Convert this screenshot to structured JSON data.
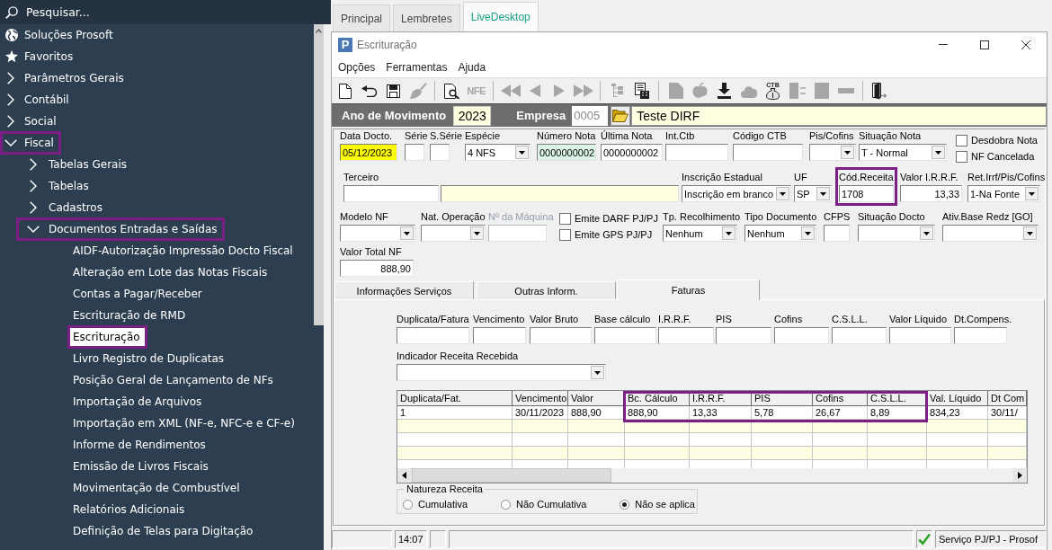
{
  "sidebar": {
    "search": {
      "placeholder": "Pesquisar..."
    },
    "items": [
      {
        "kind": "globe",
        "label": "Soluções Prosoft",
        "selected": false,
        "highlighted": false
      },
      {
        "kind": "star",
        "label": "Favoritos",
        "selected": false,
        "highlighted": false
      },
      {
        "kind": "folder",
        "label": "Parâmetros Gerais",
        "expanded": false,
        "selected": false,
        "highlighted": false
      },
      {
        "kind": "folder",
        "label": "Contábil",
        "expanded": false,
        "selected": false,
        "highlighted": false
      },
      {
        "kind": "folder",
        "label": "Social",
        "expanded": false,
        "selected": false,
        "highlighted": false
      },
      {
        "kind": "folder",
        "label": "Fiscal",
        "expanded": true,
        "selected": false,
        "highlighted": true,
        "children": [
          {
            "kind": "folder",
            "label": "Tabelas Gerais",
            "expanded": false,
            "selected": false,
            "highlighted": false
          },
          {
            "kind": "folder",
            "label": "Tabelas",
            "expanded": false,
            "selected": false,
            "highlighted": false
          },
          {
            "kind": "folder",
            "label": "Cadastros",
            "expanded": false,
            "selected": false,
            "highlighted": false
          },
          {
            "kind": "folder",
            "label": "Documentos Entradas e Saídas",
            "expanded": true,
            "selected": false,
            "highlighted": true,
            "children": [
              {
                "label": "AIDF-Autorização Impressão Docto Fiscal",
                "selected": false,
                "highlighted": false
              },
              {
                "label": "Alteração em Lote das Notas Fiscais",
                "selected": false,
                "highlighted": false
              },
              {
                "label": "Contas a Pagar/Receber",
                "selected": false,
                "highlighted": false
              },
              {
                "label": "Escrituração de RMD",
                "selected": false,
                "highlighted": false
              },
              {
                "label": "Escrituração",
                "selected": true,
                "highlighted": true
              },
              {
                "label": "Livro Registro de Duplicatas",
                "selected": false,
                "highlighted": false
              },
              {
                "label": "Posição Geral de Lançamento de NFs",
                "selected": false,
                "highlighted": false
              },
              {
                "label": "Importação de Arquivos",
                "selected": false,
                "highlighted": false
              },
              {
                "label": "Importação em XML (NF-e, NFC-e e CF-e)",
                "selected": false,
                "highlighted": false
              },
              {
                "label": "Informe de Rendimentos",
                "selected": false,
                "highlighted": false
              },
              {
                "label": "Emissão de Livros Fiscais",
                "selected": false,
                "highlighted": false
              },
              {
                "label": "Movimentação de Combustível",
                "selected": false,
                "highlighted": false
              },
              {
                "label": "Relatórios Adicionais",
                "selected": false,
                "highlighted": false
              },
              {
                "label": "Definição de Telas para Digitação",
                "selected": false,
                "highlighted": false
              }
            ]
          }
        ]
      }
    ]
  },
  "tabs": [
    {
      "label": "Principal",
      "selected": false
    },
    {
      "label": "Lembretes",
      "selected": false
    },
    {
      "label": "LiveDesktop",
      "selected": true
    }
  ],
  "window": {
    "icon_letter": "P",
    "title": "Escrituração",
    "menu": [
      "Opções",
      "Ferramentas",
      "Ajuda"
    ],
    "toolbar": [
      {
        "buttons": [
          {
            "kind": "new",
            "disabled": false
          },
          {
            "kind": "undo",
            "disabled": false
          },
          {
            "kind": "save",
            "disabled": false
          },
          {
            "kind": "brush",
            "disabled": true
          }
        ]
      },
      {
        "buttons": [
          {
            "kind": "preview",
            "disabled": false
          },
          {
            "kind": "nfe",
            "label": "NFE",
            "disabled": true
          }
        ]
      },
      {
        "buttons": [
          {
            "kind": "first",
            "disabled": true
          },
          {
            "kind": "prev",
            "disabled": true
          },
          {
            "kind": "next",
            "disabled": true
          },
          {
            "kind": "last",
            "disabled": true
          }
        ]
      },
      {
        "buttons": [
          {
            "kind": "tree",
            "disabled": true
          },
          {
            "kind": "calculator",
            "disabled": false
          }
        ]
      },
      {
        "buttons": [
          {
            "kind": "document",
            "disabled": true
          },
          {
            "kind": "apple",
            "disabled": true
          },
          {
            "kind": "download",
            "disabled": false
          },
          {
            "kind": "cloud",
            "disabled": true
          },
          {
            "kind": "money",
            "label": "CTB",
            "disabled": false
          },
          {
            "kind": "split",
            "disabled": true
          },
          {
            "kind": "square",
            "disabled": true
          },
          {
            "kind": "minus",
            "disabled": true
          }
        ]
      },
      {
        "buttons": [
          {
            "kind": "exit",
            "disabled": false
          }
        ]
      }
    ],
    "header": {
      "year": {
        "label": "Ano de Movimento",
        "value": "2023"
      },
      "company": {
        "label": "Empresa",
        "code": "0005",
        "code_disabled": true,
        "name": "Teste DIRF"
      }
    },
    "form": {
      "rows": [
        {
          "fields": [
            {
              "kind": "text",
              "label": "Data Docto.",
              "value": "05/12/2023",
              "color": "#ffff00",
              "disabled": false,
              "highlighted": false
            },
            {
              "kind": "text",
              "label": "Série",
              "disabled": false,
              "highlighted": false
            },
            {
              "kind": "text",
              "label": "S.Série",
              "disabled": false,
              "highlighted": false
            },
            {
              "kind": "select",
              "label": "Espécie",
              "value": "4 NFS",
              "disabled": false,
              "highlighted": false
            },
            {
              "kind": "text",
              "label": "Número Nota",
              "value": "0000000002",
              "color": "#ddf4e8",
              "disabled": false,
              "highlighted": false
            },
            {
              "kind": "text",
              "label": "Última Nota",
              "value": "0000000002",
              "disabled": false,
              "highlighted": false
            },
            {
              "kind": "text",
              "label": "Int.Ctb",
              "disabled": false,
              "highlighted": false
            },
            {
              "kind": "text",
              "label": "Código CTB",
              "disabled": false,
              "highlighted": false
            },
            {
              "kind": "select",
              "label": "Pis/Cofins",
              "disabled": false,
              "highlighted": false
            },
            {
              "kind": "select",
              "label": "Situação Nota",
              "value": "T - Normal",
              "disabled": false,
              "highlighted": false
            },
            {
              "kind": "checks",
              "items": [
                {
                  "label": "Desdobra Nota",
                  "checked": false
                },
                {
                  "label": "NF Cancelada",
                  "checked": false
                }
              ]
            }
          ]
        },
        {
          "fields": [
            {
              "kind": "text",
              "label": "Terceiro",
              "disabled": false,
              "highlighted": false
            },
            {
              "kind": "text",
              "color": "#ffffe1",
              "disabled": false,
              "highlighted": false
            },
            {
              "kind": "select",
              "label": "Inscrição Estadual",
              "value": "Inscrição em branco",
              "disabled": false,
              "highlighted": false
            },
            {
              "kind": "select",
              "label": "UF",
              "value": "SP",
              "disabled": false,
              "highlighted": false
            },
            {
              "kind": "text",
              "label": "Cód.Receita",
              "value": "1708",
              "disabled": false,
              "highlighted": true
            },
            {
              "kind": "number",
              "label": "Valor I.R.R.F.",
              "value": "13,33",
              "disabled": false,
              "highlighted": false
            },
            {
              "kind": "select",
              "label": "Ret.Irrf/Pis/Cofins",
              "value": "1-Na Fonte",
              "disabled": false,
              "highlighted": false
            }
          ]
        },
        {
          "fields": [
            {
              "kind": "select",
              "label": "Modelo NF",
              "disabled": false,
              "highlighted": false
            },
            {
              "kind": "select",
              "label": "Nat. Operação",
              "disabled": false,
              "highlighted": false
            },
            {
              "kind": "text",
              "label": "Nº da Máquina",
              "disabled": true,
              "highlighted": false
            },
            {
              "kind": "checks",
              "items": [
                {
                  "label": "Emite DARF PJ/PJ",
                  "checked": false
                },
                {
                  "label": "Emite GPS PJ/PJ",
                  "checked": false
                }
              ]
            },
            {
              "kind": "select",
              "label": "Tp. Recolhimento",
              "value": "Nenhum",
              "disabled": false,
              "highlighted": false
            },
            {
              "kind": "select",
              "label": "Tipo Documento",
              "value": "Nenhum",
              "disabled": false,
              "highlighted": false
            },
            {
              "kind": "text",
              "label": "CFPS",
              "disabled": false,
              "highlighted": false
            },
            {
              "kind": "select",
              "label": "Situação Docto",
              "disabled": false,
              "highlighted": false
            },
            {
              "kind": "select",
              "label": "Ativ.Base Redz [GO]",
              "disabled": false,
              "highlighted": false
            }
          ]
        },
        {
          "fields": [
            {
              "kind": "number",
              "label": "Valor Total NF",
              "value": "888,90",
              "disabled": false,
              "highlighted": false
            }
          ]
        }
      ]
    },
    "subtabs": [
      {
        "label": "Informações Serviços",
        "selected": false
      },
      {
        "label": "Outras Inform.",
        "selected": false
      },
      {
        "label": "Faturas",
        "selected": true
      }
    ],
    "faturas": {
      "fields": [
        {
          "label": "Duplicata/Fatura"
        },
        {
          "label": "Vencimento"
        },
        {
          "label": "Valor Bruto"
        },
        {
          "label": "Base cálculo"
        },
        {
          "label": "I.R.R.F."
        },
        {
          "label": "PIS"
        },
        {
          "label": "Cofins"
        },
        {
          "label": "C.S.L.L."
        },
        {
          "label": "Valor Líquido"
        },
        {
          "label": "Dt.Compens."
        }
      ],
      "indicator": {
        "label": "Indicador Receita Recebida"
      },
      "table": {
        "columns": [
          {
            "label": "Duplicata/Fat.",
            "highlighted": false
          },
          {
            "label": "Vencimento",
            "highlighted": false
          },
          {
            "label": "Valor",
            "highlighted": false
          },
          {
            "label": "Bc. Cálculo",
            "highlighted": true
          },
          {
            "label": "I.R.R.F.",
            "highlighted": true
          },
          {
            "label": "PIS",
            "highlighted": true
          },
          {
            "label": "Cofins",
            "highlighted": true
          },
          {
            "label": "C.S.L.L.",
            "highlighted": true
          },
          {
            "label": "Val. Líquido",
            "highlighted": false
          },
          {
            "label": "Dt Com",
            "highlighted": false
          }
        ],
        "rows": [
          [
            "1",
            "30/11/2023",
            "888,90",
            "888,90",
            "13,33",
            "5,78",
            "26,67",
            "8,89",
            "834,23",
            "30/11/"
          ]
        ]
      },
      "natureza": {
        "label": "Natureza Receita",
        "options": [
          {
            "label": "Cumulativa",
            "selected": false
          },
          {
            "label": "Não Cumulativa",
            "selected": false
          },
          {
            "label": "Não se aplica",
            "selected": true
          }
        ]
      }
    },
    "status_bar": {
      "time": "14:07",
      "ok": true,
      "message": "Serviço PJ/PJ - Prosof"
    }
  }
}
